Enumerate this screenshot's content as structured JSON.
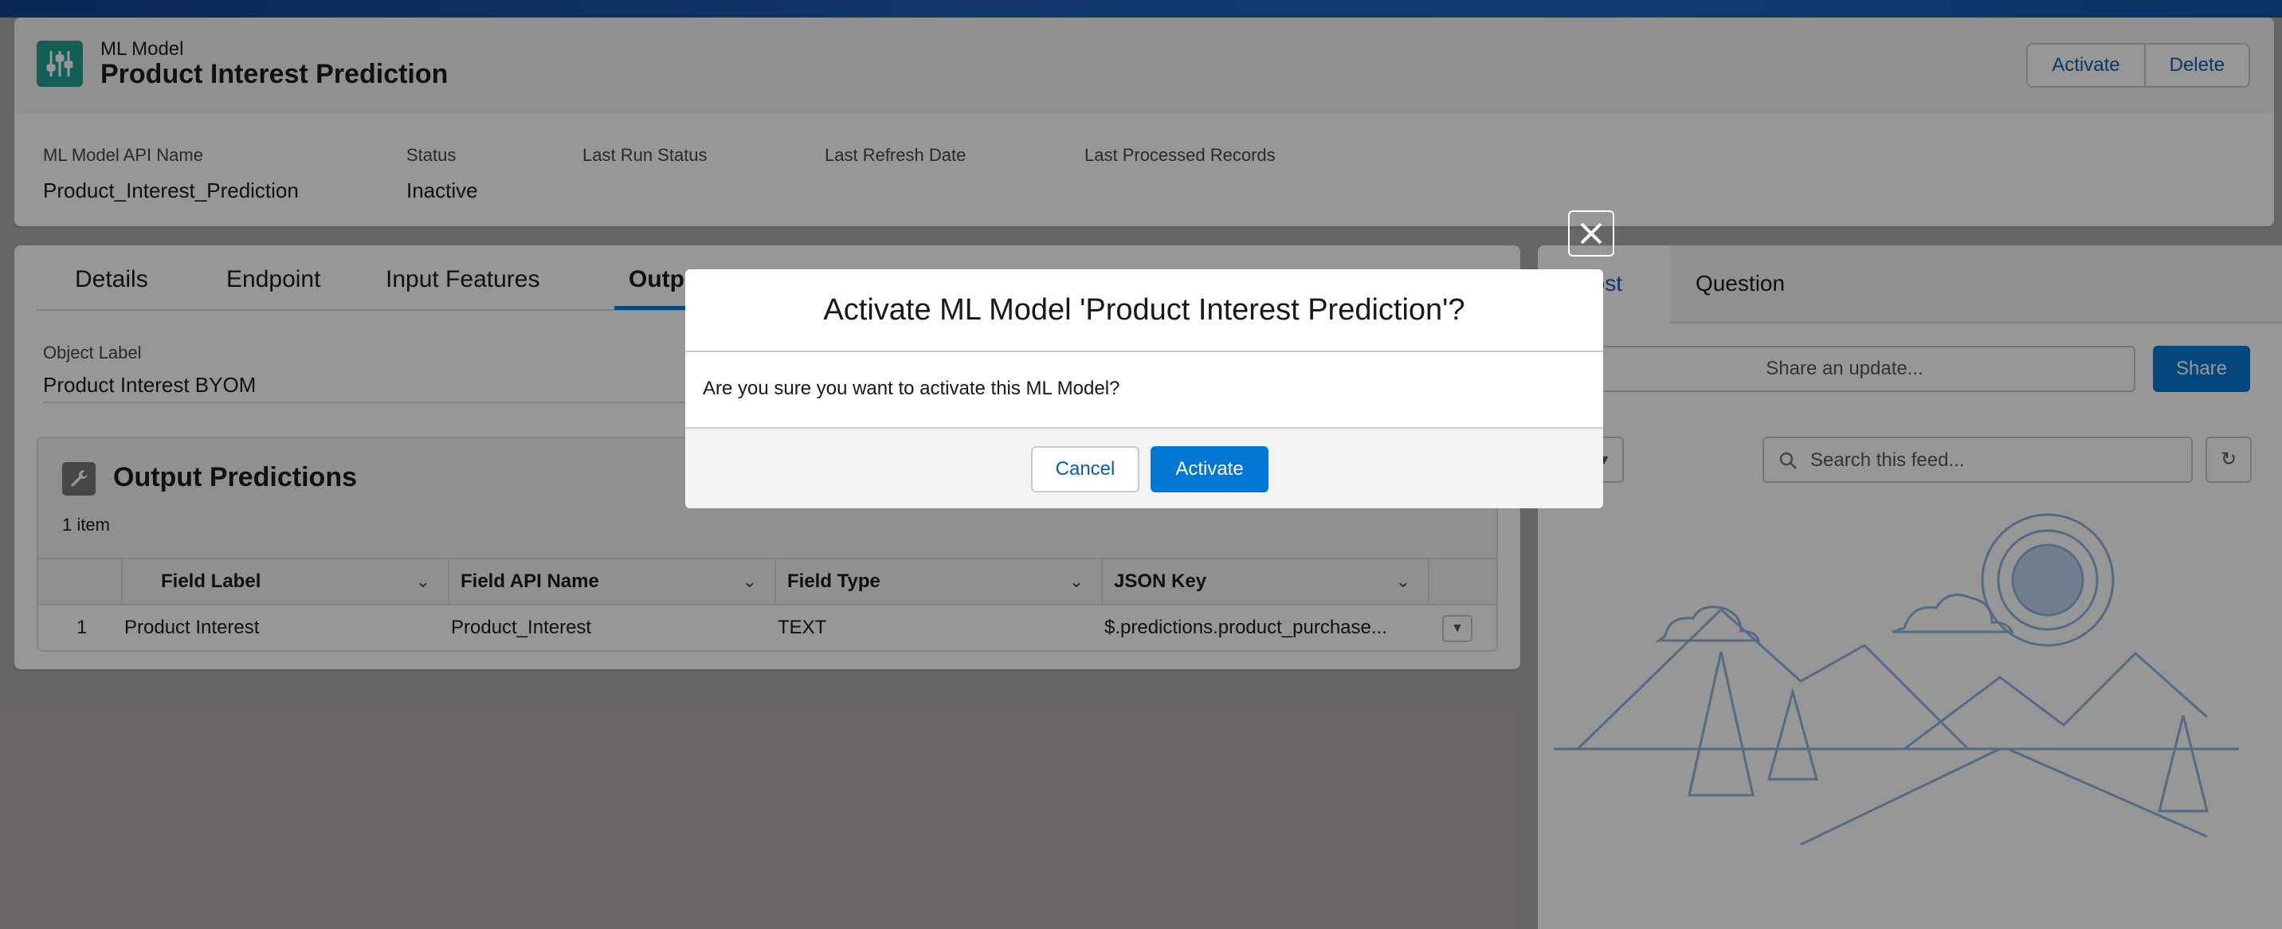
{
  "record": {
    "entity_type": "ML Model",
    "title": "Product Interest Prediction",
    "actions": [
      "Activate",
      "Delete"
    ]
  },
  "highlights": [
    {
      "label": "ML Model API Name",
      "value": "Product_Interest_Prediction"
    },
    {
      "label": "Status",
      "value": "Inactive"
    },
    {
      "label": "Last Run Status",
      "value": ""
    },
    {
      "label": "Last Refresh Date",
      "value": ""
    },
    {
      "label": "Last Processed Records",
      "value": ""
    }
  ],
  "tabs": [
    "Details",
    "Endpoint",
    "Input Features",
    "Output Predictions"
  ],
  "active_tab": "Output Predictions",
  "object": {
    "label": "Object Label",
    "value": "Product Interest BYOM"
  },
  "related_list": {
    "title": "Output Predictions",
    "count": "1 item",
    "columns": [
      "Field Label",
      "Field API Name",
      "Field Type",
      "JSON Key"
    ],
    "rows": [
      {
        "num": "1",
        "field_label": "Product Interest",
        "field_api_name": "Product_Interest",
        "field_type": "TEXT",
        "json_key": "$.predictions.product_purchase..."
      }
    ]
  },
  "feed": {
    "tabs": [
      "Post",
      "Question"
    ],
    "share_placeholder": "Share an update...",
    "share_button": "Share",
    "search_placeholder": "Search this feed..."
  },
  "modal": {
    "title": "Activate ML Model 'Product Interest Prediction'?",
    "body": "Are you sure you want to activate this ML Model?",
    "cancel": "Cancel",
    "confirm": "Activate"
  },
  "colors": {
    "brand": "#0176d3",
    "model_icon": "#1f9e8d",
    "link": "#0b5cab"
  }
}
